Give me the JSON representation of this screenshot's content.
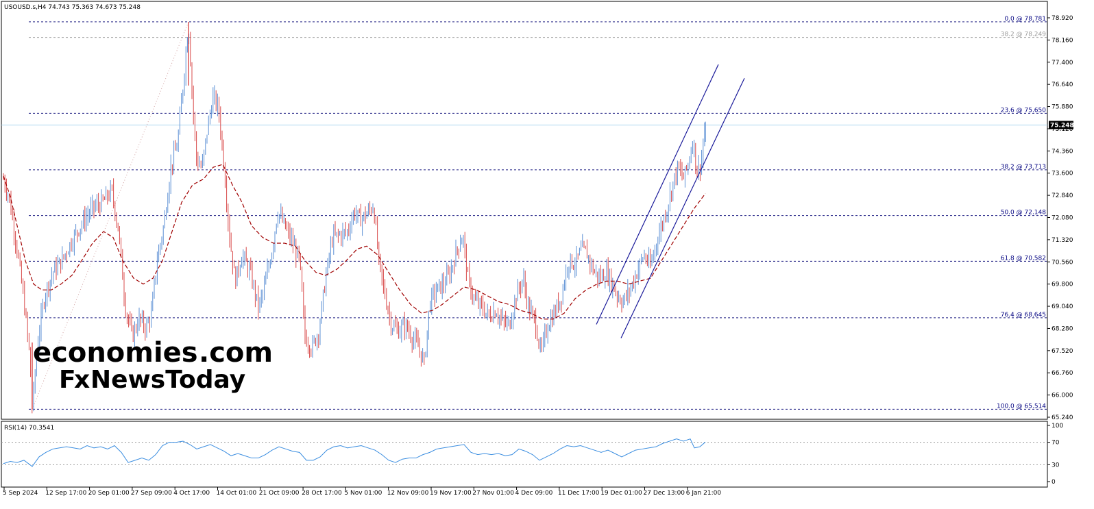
{
  "header": {
    "symbol_info": "USOUSD.s,H4  74.743 75.363 74.673 75.248"
  },
  "rsi_header": "RSI(14) 70.3541",
  "watermark": {
    "line1_colored": "economies",
    "line1_suffix": ".com",
    "line2_prefix": "F",
    "line2_x": "x",
    "line2_rest": "NewsToday"
  },
  "colors": {
    "bull_candle": "#5b8fd4",
    "bear_candle": "#d94a4a",
    "ma_line": "#a00000",
    "fib_line": "#1a1a80",
    "fib_382_upper": "#a0a0a0",
    "current_price_line": "#a8d4f0",
    "current_price_badge_bg": "#000000",
    "channel_line": "#1a1a9a",
    "rsi_line": "#3a8de0",
    "watermark_orange": "#f5a86a",
    "watermark_gray": "#c8c8c8"
  },
  "chart_data": {
    "type": "candlestick",
    "symbol": "USOUSD.s",
    "timeframe": "H4",
    "ohlc_last": {
      "open": 74.743,
      "high": 75.363,
      "low": 74.673,
      "close": 75.248
    },
    "current_price_label": "75.248",
    "ylim": [
      65.24,
      79.2
    ],
    "price_ticks": [
      "78.920",
      "78.160",
      "77.400",
      "76.640",
      "75.880",
      "75.120",
      "74.360",
      "73.600",
      "72.840",
      "72.080",
      "71.320",
      "70.560",
      "69.800",
      "69.040",
      "68.280",
      "67.520",
      "66.760",
      "66.000",
      "65.240"
    ],
    "fib_levels": [
      {
        "label": "0.0 @ 78.781",
        "value": 78.781
      },
      {
        "label": "38.2 @ 78.249",
        "value": 78.249
      },
      {
        "label": "23.6 @ 75.650",
        "value": 75.65
      },
      {
        "label": "38.2 @ 73.713",
        "value": 73.713
      },
      {
        "label": "50.0 @ 72.148",
        "value": 72.148
      },
      {
        "label": "61.8 @ 70.582",
        "value": 70.582
      },
      {
        "label": "76.4 @ 68.645",
        "value": 68.645
      },
      {
        "label": "100.0 @ 65.514",
        "value": 65.514
      }
    ],
    "time_labels": [
      "5 Sep 2024",
      "12 Sep 17:00",
      "20 Sep 01:00",
      "27 Sep 09:00",
      "4 Oct 17:00",
      "14 Oct 01:00",
      "21 Oct 09:00",
      "28 Oct 17:00",
      "5 Nov 01:00",
      "12 Nov 09:00",
      "19 Nov 17:00",
      "27 Nov 01:00",
      "4 Dec 09:00",
      "11 Dec 17:00",
      "19 Dec 01:00",
      "27 Dec 13:00",
      "6 Jan 21:00"
    ],
    "price_path": [
      [
        0,
        73.4
      ],
      [
        8,
        72.8
      ],
      [
        20,
        71.0
      ],
      [
        30,
        69.2
      ],
      [
        38,
        67.4
      ],
      [
        42,
        65.55
      ],
      [
        50,
        67.8
      ],
      [
        60,
        69.4
      ],
      [
        72,
        70.2
      ],
      [
        85,
        70.6
      ],
      [
        100,
        71.3
      ],
      [
        115,
        71.9
      ],
      [
        130,
        72.4
      ],
      [
        145,
        72.6
      ],
      [
        158,
        73.0
      ],
      [
        168,
        71.6
      ],
      [
        178,
        69.0
      ],
      [
        188,
        68.0
      ],
      [
        198,
        68.6
      ],
      [
        208,
        68.3
      ],
      [
        216,
        68.8
      ],
      [
        224,
        70.6
      ],
      [
        234,
        71.8
      ],
      [
        244,
        73.8
      ],
      [
        254,
        74.6
      ],
      [
        262,
        76.6
      ],
      [
        270,
        78.78
      ],
      [
        276,
        76.0
      ],
      [
        282,
        74.0
      ],
      [
        290,
        73.8
      ],
      [
        298,
        75.2
      ],
      [
        306,
        76.2
      ],
      [
        314,
        75.8
      ],
      [
        322,
        73.8
      ],
      [
        330,
        71.4
      ],
      [
        338,
        69.9
      ],
      [
        348,
        70.8
      ],
      [
        360,
        70.2
      ],
      [
        372,
        69.0
      ],
      [
        380,
        69.6
      ],
      [
        392,
        71.0
      ],
      [
        400,
        72.3
      ],
      [
        410,
        71.8
      ],
      [
        420,
        71.3
      ],
      [
        432,
        70.6
      ],
      [
        440,
        68.0
      ],
      [
        450,
        67.6
      ],
      [
        460,
        68.2
      ],
      [
        470,
        70.0
      ],
      [
        480,
        71.4
      ],
      [
        492,
        71.5
      ],
      [
        502,
        71.6
      ],
      [
        512,
        72.3
      ],
      [
        520,
        72.0
      ],
      [
        530,
        72.2
      ],
      [
        540,
        72.5
      ],
      [
        548,
        70.5
      ],
      [
        556,
        69.5
      ],
      [
        566,
        68.4
      ],
      [
        576,
        68.2
      ],
      [
        586,
        68.4
      ],
      [
        596,
        68.0
      ],
      [
        606,
        67.6
      ],
      [
        614,
        67.1
      ],
      [
        622,
        69.2
      ],
      [
        632,
        69.6
      ],
      [
        642,
        69.8
      ],
      [
        652,
        70.2
      ],
      [
        662,
        71.0
      ],
      [
        670,
        71.5
      ],
      [
        678,
        69.9
      ],
      [
        688,
        69.2
      ],
      [
        698,
        69.0
      ],
      [
        708,
        68.7
      ],
      [
        718,
        68.9
      ],
      [
        728,
        68.5
      ],
      [
        738,
        68.4
      ],
      [
        748,
        69.4
      ],
      [
        758,
        70.0
      ],
      [
        766,
        69.0
      ],
      [
        776,
        68.5
      ],
      [
        784,
        67.4
      ],
      [
        794,
        68.4
      ],
      [
        804,
        68.8
      ],
      [
        814,
        69.4
      ],
      [
        824,
        70.6
      ],
      [
        834,
        70.5
      ],
      [
        844,
        71.0
      ],
      [
        852,
        70.8
      ],
      [
        862,
        70.2
      ],
      [
        870,
        70.0
      ],
      [
        880,
        70.2
      ],
      [
        888,
        69.8
      ],
      [
        896,
        69.4
      ],
      [
        904,
        69.2
      ],
      [
        914,
        69.6
      ],
      [
        924,
        70.2
      ],
      [
        934,
        70.8
      ],
      [
        944,
        70.4
      ],
      [
        952,
        71.2
      ],
      [
        960,
        71.8
      ],
      [
        968,
        72.4
      ],
      [
        976,
        73.2
      ],
      [
        984,
        73.8
      ],
      [
        992,
        73.4
      ],
      [
        1000,
        74.0
      ],
      [
        1006,
        74.8
      ],
      [
        1012,
        73.6
      ],
      [
        1018,
        74.0
      ],
      [
        1024,
        75.25
      ]
    ],
    "moving_average": [
      [
        0,
        73.5
      ],
      [
        10,
        72.8
      ],
      [
        20,
        71.8
      ],
      [
        32,
        70.6
      ],
      [
        44,
        69.8
      ],
      [
        56,
        69.6
      ],
      [
        70,
        69.6
      ],
      [
        84,
        69.8
      ],
      [
        100,
        70.1
      ],
      [
        114,
        70.6
      ],
      [
        130,
        71.2
      ],
      [
        146,
        71.6
      ],
      [
        160,
        71.4
      ],
      [
        174,
        70.6
      ],
      [
        190,
        70.0
      ],
      [
        204,
        69.8
      ],
      [
        218,
        70.0
      ],
      [
        232,
        70.6
      ],
      [
        246,
        71.6
      ],
      [
        260,
        72.6
      ],
      [
        276,
        73.2
      ],
      [
        292,
        73.4
      ],
      [
        306,
        73.8
      ],
      [
        320,
        73.9
      ],
      [
        334,
        73.2
      ],
      [
        348,
        72.6
      ],
      [
        362,
        71.8
      ],
      [
        378,
        71.4
      ],
      [
        394,
        71.2
      ],
      [
        410,
        71.2
      ],
      [
        426,
        71.1
      ],
      [
        440,
        70.6
      ],
      [
        456,
        70.2
      ],
      [
        470,
        70.1
      ],
      [
        486,
        70.3
      ],
      [
        500,
        70.6
      ],
      [
        516,
        71.0
      ],
      [
        530,
        71.1
      ],
      [
        546,
        70.8
      ],
      [
        562,
        70.2
      ],
      [
        578,
        69.6
      ],
      [
        594,
        69.1
      ],
      [
        610,
        68.8
      ],
      [
        626,
        68.9
      ],
      [
        640,
        69.1
      ],
      [
        656,
        69.4
      ],
      [
        672,
        69.7
      ],
      [
        690,
        69.6
      ],
      [
        706,
        69.4
      ],
      [
        722,
        69.2
      ],
      [
        738,
        69.1
      ],
      [
        754,
        68.9
      ],
      [
        770,
        68.8
      ],
      [
        786,
        68.6
      ],
      [
        802,
        68.6
      ],
      [
        818,
        68.8
      ],
      [
        834,
        69.3
      ],
      [
        850,
        69.6
      ],
      [
        866,
        69.8
      ],
      [
        880,
        69.9
      ],
      [
        896,
        69.9
      ],
      [
        912,
        69.8
      ],
      [
        928,
        69.9
      ],
      [
        944,
        70.0
      ],
      [
        960,
        70.6
      ],
      [
        976,
        71.2
      ],
      [
        992,
        71.8
      ],
      [
        1008,
        72.4
      ],
      [
        1024,
        72.9
      ]
    ],
    "channel_lines": [
      {
        "x1": 870,
        "y1": 68.42,
        "x2": 1048,
        "y2": 77.32
      },
      {
        "x1": 906,
        "y1": 67.95,
        "x2": 1086,
        "y2": 76.85
      }
    ],
    "fib_trend_line": {
      "x1": 42,
      "y1": 65.514,
      "x2": 270,
      "y2": 78.781
    },
    "rsi": {
      "name": "RSI(14)",
      "value": 70.3541,
      "ylim": [
        0,
        100
      ],
      "ticks": [
        "100",
        "70",
        "30",
        "0"
      ],
      "levels": [
        70,
        30
      ],
      "path": [
        [
          0,
          32
        ],
        [
          10,
          36
        ],
        [
          20,
          34
        ],
        [
          30,
          38
        ],
        [
          42,
          27
        ],
        [
          52,
          44
        ],
        [
          62,
          52
        ],
        [
          72,
          58
        ],
        [
          82,
          60
        ],
        [
          92,
          62
        ],
        [
          102,
          60
        ],
        [
          112,
          58
        ],
        [
          122,
          64
        ],
        [
          132,
          60
        ],
        [
          142,
          62
        ],
        [
          152,
          58
        ],
        [
          162,
          64
        ],
        [
          172,
          52
        ],
        [
          182,
          34
        ],
        [
          192,
          38
        ],
        [
          202,
          42
        ],
        [
          212,
          38
        ],
        [
          222,
          48
        ],
        [
          232,
          64
        ],
        [
          242,
          70
        ],
        [
          252,
          70
        ],
        [
          262,
          72
        ],
        [
          272,
          66
        ],
        [
          282,
          58
        ],
        [
          292,
          62
        ],
        [
          302,
          66
        ],
        [
          312,
          60
        ],
        [
          322,
          54
        ],
        [
          332,
          46
        ],
        [
          342,
          50
        ],
        [
          352,
          46
        ],
        [
          362,
          42
        ],
        [
          372,
          42
        ],
        [
          382,
          48
        ],
        [
          392,
          56
        ],
        [
          402,
          62
        ],
        [
          412,
          58
        ],
        [
          422,
          54
        ],
        [
          432,
          52
        ],
        [
          442,
          38
        ],
        [
          452,
          38
        ],
        [
          462,
          44
        ],
        [
          472,
          56
        ],
        [
          482,
          62
        ],
        [
          492,
          64
        ],
        [
          502,
          60
        ],
        [
          512,
          62
        ],
        [
          522,
          64
        ],
        [
          532,
          60
        ],
        [
          542,
          56
        ],
        [
          552,
          48
        ],
        [
          562,
          38
        ],
        [
          572,
          34
        ],
        [
          582,
          40
        ],
        [
          592,
          42
        ],
        [
          602,
          42
        ],
        [
          612,
          48
        ],
        [
          622,
          52
        ],
        [
          632,
          58
        ],
        [
          642,
          60
        ],
        [
          652,
          62
        ],
        [
          662,
          64
        ],
        [
          672,
          66
        ],
        [
          682,
          52
        ],
        [
          692,
          48
        ],
        [
          702,
          50
        ],
        [
          712,
          48
        ],
        [
          722,
          50
        ],
        [
          732,
          46
        ],
        [
          742,
          48
        ],
        [
          752,
          58
        ],
        [
          762,
          54
        ],
        [
          772,
          48
        ],
        [
          782,
          38
        ],
        [
          792,
          44
        ],
        [
          802,
          50
        ],
        [
          812,
          58
        ],
        [
          822,
          64
        ],
        [
          832,
          62
        ],
        [
          842,
          64
        ],
        [
          852,
          60
        ],
        [
          862,
          56
        ],
        [
          872,
          52
        ],
        [
          882,
          56
        ],
        [
          892,
          50
        ],
        [
          902,
          44
        ],
        [
          912,
          50
        ],
        [
          922,
          56
        ],
        [
          932,
          58
        ],
        [
          942,
          60
        ],
        [
          952,
          62
        ],
        [
          962,
          68
        ],
        [
          972,
          72
        ],
        [
          982,
          76
        ],
        [
          992,
          72
        ],
        [
          1002,
          76
        ],
        [
          1008,
          60
        ],
        [
          1016,
          62
        ],
        [
          1024,
          70.35
        ]
      ]
    }
  }
}
